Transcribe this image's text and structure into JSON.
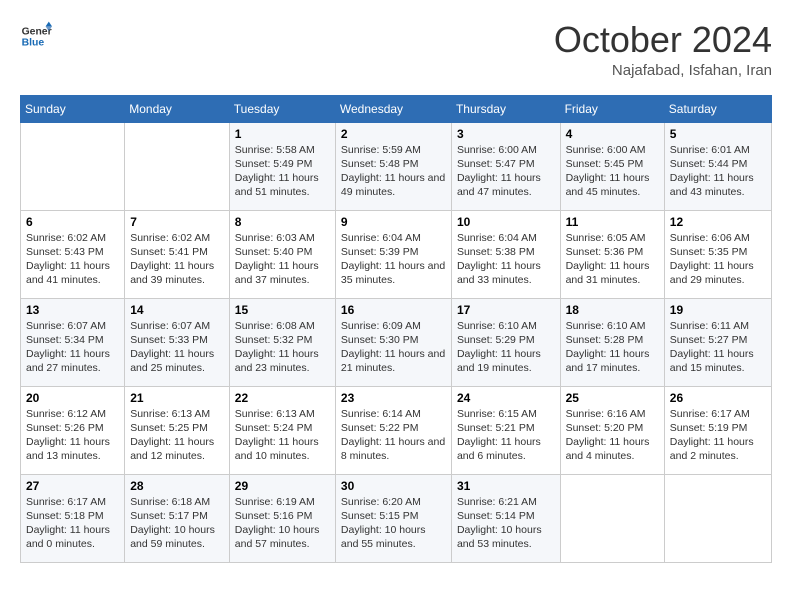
{
  "header": {
    "logo_line1": "General",
    "logo_line2": "Blue",
    "month_year": "October 2024",
    "location": "Najafabad, Isfahan, Iran"
  },
  "weekdays": [
    "Sunday",
    "Monday",
    "Tuesday",
    "Wednesday",
    "Thursday",
    "Friday",
    "Saturday"
  ],
  "weeks": [
    [
      {
        "day": "",
        "sunrise": "",
        "sunset": "",
        "daylight": ""
      },
      {
        "day": "",
        "sunrise": "",
        "sunset": "",
        "daylight": ""
      },
      {
        "day": "1",
        "sunrise": "Sunrise: 5:58 AM",
        "sunset": "Sunset: 5:49 PM",
        "daylight": "Daylight: 11 hours and 51 minutes."
      },
      {
        "day": "2",
        "sunrise": "Sunrise: 5:59 AM",
        "sunset": "Sunset: 5:48 PM",
        "daylight": "Daylight: 11 hours and 49 minutes."
      },
      {
        "day": "3",
        "sunrise": "Sunrise: 6:00 AM",
        "sunset": "Sunset: 5:47 PM",
        "daylight": "Daylight: 11 hours and 47 minutes."
      },
      {
        "day": "4",
        "sunrise": "Sunrise: 6:00 AM",
        "sunset": "Sunset: 5:45 PM",
        "daylight": "Daylight: 11 hours and 45 minutes."
      },
      {
        "day": "5",
        "sunrise": "Sunrise: 6:01 AM",
        "sunset": "Sunset: 5:44 PM",
        "daylight": "Daylight: 11 hours and 43 minutes."
      }
    ],
    [
      {
        "day": "6",
        "sunrise": "Sunrise: 6:02 AM",
        "sunset": "Sunset: 5:43 PM",
        "daylight": "Daylight: 11 hours and 41 minutes."
      },
      {
        "day": "7",
        "sunrise": "Sunrise: 6:02 AM",
        "sunset": "Sunset: 5:41 PM",
        "daylight": "Daylight: 11 hours and 39 minutes."
      },
      {
        "day": "8",
        "sunrise": "Sunrise: 6:03 AM",
        "sunset": "Sunset: 5:40 PM",
        "daylight": "Daylight: 11 hours and 37 minutes."
      },
      {
        "day": "9",
        "sunrise": "Sunrise: 6:04 AM",
        "sunset": "Sunset: 5:39 PM",
        "daylight": "Daylight: 11 hours and 35 minutes."
      },
      {
        "day": "10",
        "sunrise": "Sunrise: 6:04 AM",
        "sunset": "Sunset: 5:38 PM",
        "daylight": "Daylight: 11 hours and 33 minutes."
      },
      {
        "day": "11",
        "sunrise": "Sunrise: 6:05 AM",
        "sunset": "Sunset: 5:36 PM",
        "daylight": "Daylight: 11 hours and 31 minutes."
      },
      {
        "day": "12",
        "sunrise": "Sunrise: 6:06 AM",
        "sunset": "Sunset: 5:35 PM",
        "daylight": "Daylight: 11 hours and 29 minutes."
      }
    ],
    [
      {
        "day": "13",
        "sunrise": "Sunrise: 6:07 AM",
        "sunset": "Sunset: 5:34 PM",
        "daylight": "Daylight: 11 hours and 27 minutes."
      },
      {
        "day": "14",
        "sunrise": "Sunrise: 6:07 AM",
        "sunset": "Sunset: 5:33 PM",
        "daylight": "Daylight: 11 hours and 25 minutes."
      },
      {
        "day": "15",
        "sunrise": "Sunrise: 6:08 AM",
        "sunset": "Sunset: 5:32 PM",
        "daylight": "Daylight: 11 hours and 23 minutes."
      },
      {
        "day": "16",
        "sunrise": "Sunrise: 6:09 AM",
        "sunset": "Sunset: 5:30 PM",
        "daylight": "Daylight: 11 hours and 21 minutes."
      },
      {
        "day": "17",
        "sunrise": "Sunrise: 6:10 AM",
        "sunset": "Sunset: 5:29 PM",
        "daylight": "Daylight: 11 hours and 19 minutes."
      },
      {
        "day": "18",
        "sunrise": "Sunrise: 6:10 AM",
        "sunset": "Sunset: 5:28 PM",
        "daylight": "Daylight: 11 hours and 17 minutes."
      },
      {
        "day": "19",
        "sunrise": "Sunrise: 6:11 AM",
        "sunset": "Sunset: 5:27 PM",
        "daylight": "Daylight: 11 hours and 15 minutes."
      }
    ],
    [
      {
        "day": "20",
        "sunrise": "Sunrise: 6:12 AM",
        "sunset": "Sunset: 5:26 PM",
        "daylight": "Daylight: 11 hours and 13 minutes."
      },
      {
        "day": "21",
        "sunrise": "Sunrise: 6:13 AM",
        "sunset": "Sunset: 5:25 PM",
        "daylight": "Daylight: 11 hours and 12 minutes."
      },
      {
        "day": "22",
        "sunrise": "Sunrise: 6:13 AM",
        "sunset": "Sunset: 5:24 PM",
        "daylight": "Daylight: 11 hours and 10 minutes."
      },
      {
        "day": "23",
        "sunrise": "Sunrise: 6:14 AM",
        "sunset": "Sunset: 5:22 PM",
        "daylight": "Daylight: 11 hours and 8 minutes."
      },
      {
        "day": "24",
        "sunrise": "Sunrise: 6:15 AM",
        "sunset": "Sunset: 5:21 PM",
        "daylight": "Daylight: 11 hours and 6 minutes."
      },
      {
        "day": "25",
        "sunrise": "Sunrise: 6:16 AM",
        "sunset": "Sunset: 5:20 PM",
        "daylight": "Daylight: 11 hours and 4 minutes."
      },
      {
        "day": "26",
        "sunrise": "Sunrise: 6:17 AM",
        "sunset": "Sunset: 5:19 PM",
        "daylight": "Daylight: 11 hours and 2 minutes."
      }
    ],
    [
      {
        "day": "27",
        "sunrise": "Sunrise: 6:17 AM",
        "sunset": "Sunset: 5:18 PM",
        "daylight": "Daylight: 11 hours and 0 minutes."
      },
      {
        "day": "28",
        "sunrise": "Sunrise: 6:18 AM",
        "sunset": "Sunset: 5:17 PM",
        "daylight": "Daylight: 10 hours and 59 minutes."
      },
      {
        "day": "29",
        "sunrise": "Sunrise: 6:19 AM",
        "sunset": "Sunset: 5:16 PM",
        "daylight": "Daylight: 10 hours and 57 minutes."
      },
      {
        "day": "30",
        "sunrise": "Sunrise: 6:20 AM",
        "sunset": "Sunset: 5:15 PM",
        "daylight": "Daylight: 10 hours and 55 minutes."
      },
      {
        "day": "31",
        "sunrise": "Sunrise: 6:21 AM",
        "sunset": "Sunset: 5:14 PM",
        "daylight": "Daylight: 10 hours and 53 minutes."
      },
      {
        "day": "",
        "sunrise": "",
        "sunset": "",
        "daylight": ""
      },
      {
        "day": "",
        "sunrise": "",
        "sunset": "",
        "daylight": ""
      }
    ]
  ]
}
